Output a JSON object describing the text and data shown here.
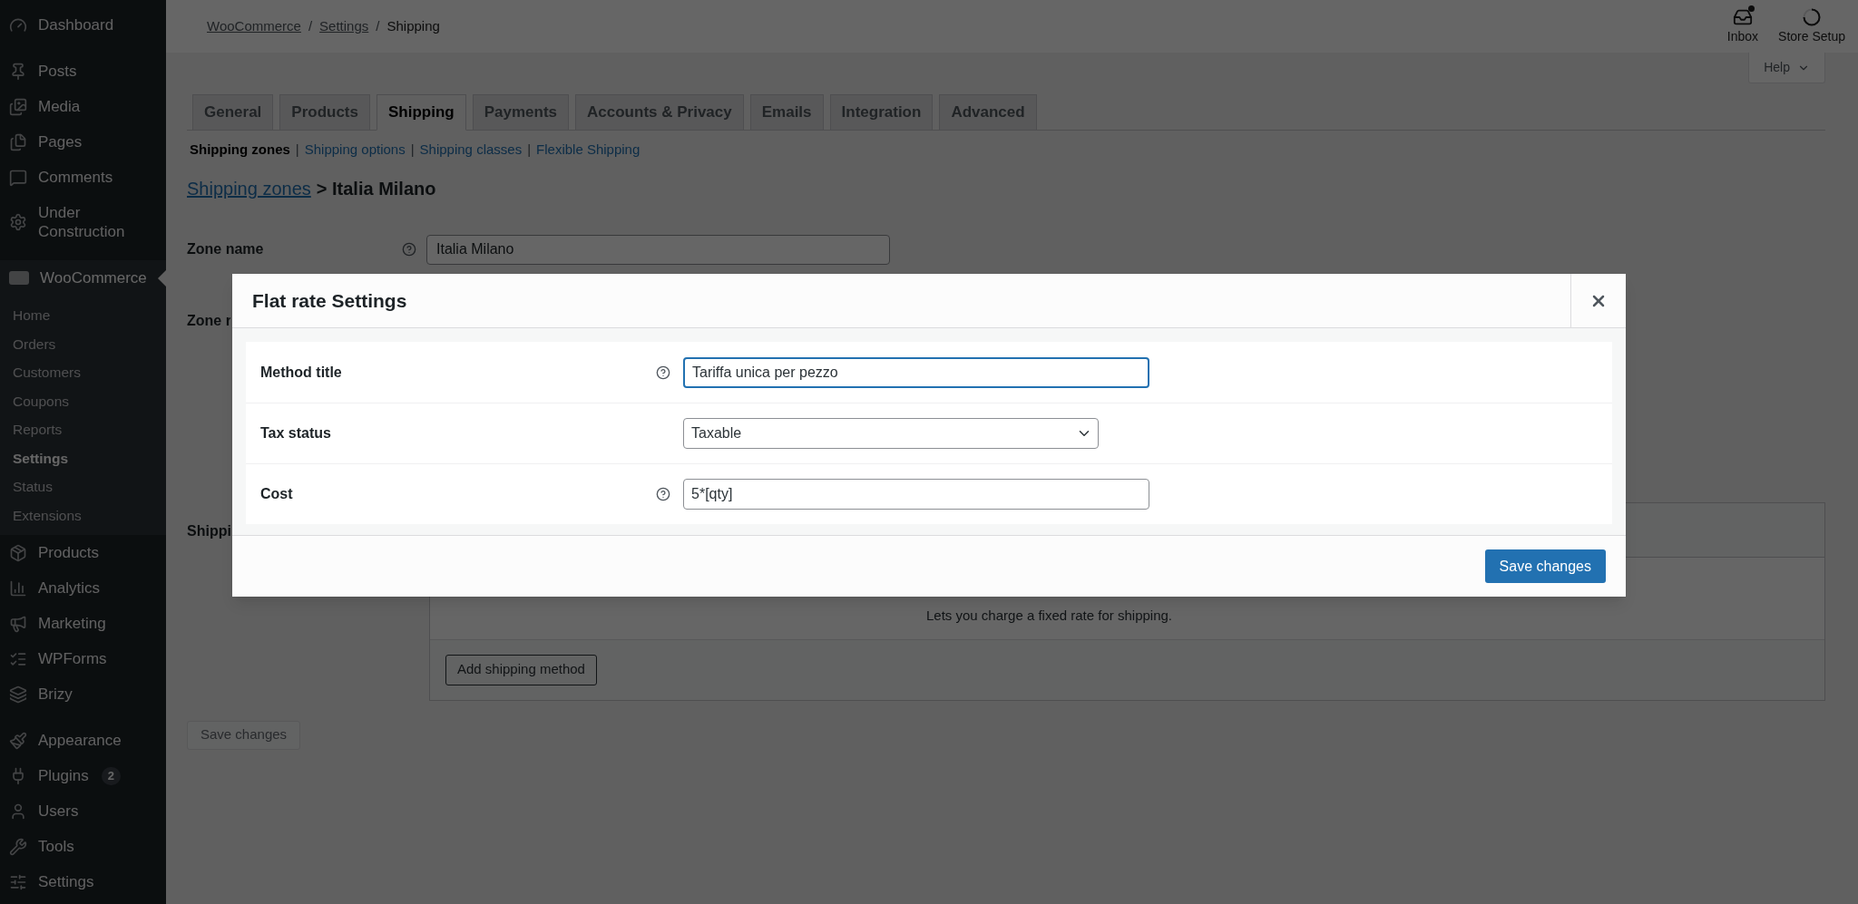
{
  "sidebar": {
    "sections": [
      [
        {
          "label": "Dashboard",
          "selected": false
        }
      ],
      [
        {
          "label": "Posts",
          "selected": false
        },
        {
          "label": "Media",
          "selected": false
        },
        {
          "label": "Pages",
          "selected": false
        },
        {
          "label": "Comments",
          "selected": false
        },
        {
          "label": "Under Construction",
          "selected": false
        }
      ],
      [
        {
          "label": "WooCommerce",
          "selected": true,
          "children": [
            {
              "label": "Home",
              "selected": false
            },
            {
              "label": "Orders",
              "selected": false
            },
            {
              "label": "Customers",
              "selected": false
            },
            {
              "label": "Coupons",
              "selected": false
            },
            {
              "label": "Reports",
              "selected": false
            },
            {
              "label": "Settings",
              "selected": true
            },
            {
              "label": "Status",
              "selected": false
            },
            {
              "label": "Extensions",
              "selected": false
            }
          ]
        },
        {
          "label": "Products",
          "selected": false
        },
        {
          "label": "Analytics",
          "selected": false
        },
        {
          "label": "Marketing",
          "selected": false
        },
        {
          "label": "WPForms",
          "selected": false
        },
        {
          "label": "Brizy",
          "selected": false
        }
      ],
      [
        {
          "label": "Appearance",
          "selected": false
        },
        {
          "label": "Plugins",
          "selected": false,
          "badge": "2"
        },
        {
          "label": "Users",
          "selected": false
        },
        {
          "label": "Tools",
          "selected": false
        },
        {
          "label": "Settings",
          "selected": false
        }
      ]
    ]
  },
  "breadcrumb": {
    "separator": "/",
    "items": [
      {
        "label": "WooCommerce",
        "link": true
      },
      {
        "label": "Settings",
        "link": true
      },
      {
        "label": "Shipping",
        "link": false
      }
    ]
  },
  "top_actions": [
    {
      "label": "Inbox"
    },
    {
      "label": "Store Setup"
    }
  ],
  "help_button": {
    "label": "Help"
  },
  "tabs": [
    {
      "label": "General",
      "selected": false
    },
    {
      "label": "Products",
      "selected": false
    },
    {
      "label": "Shipping",
      "selected": true
    },
    {
      "label": "Payments",
      "selected": false
    },
    {
      "label": "Accounts & Privacy",
      "selected": false
    },
    {
      "label": "Emails",
      "selected": false
    },
    {
      "label": "Integration",
      "selected": false
    },
    {
      "label": "Advanced",
      "selected": false
    }
  ],
  "subnav": {
    "separator": "|",
    "items": [
      {
        "label": "Shipping zones",
        "selected": true
      },
      {
        "label": "Shipping options",
        "selected": false
      },
      {
        "label": "Shipping classes",
        "selected": false
      },
      {
        "label": "Flexible Shipping",
        "selected": false
      }
    ]
  },
  "heading": {
    "link": "Shipping zones",
    "rest": "> Italia Milano"
  },
  "zone_name": {
    "label": "Zone name",
    "value": "Italia Milano"
  },
  "zone_regions_label": "Zone r",
  "shipping_methods_label": "Shippi",
  "methods_table": {
    "description": "Lets you charge a fixed rate for shipping.",
    "add_button": "Add shipping method"
  },
  "page_save_button": {
    "label": "Save changes",
    "disabled": true
  },
  "modal": {
    "title": "Flat rate Settings",
    "fields": [
      {
        "kind": "text",
        "label": "Method title",
        "help": true,
        "value": "Tariffa unica per pezzo",
        "focused": true
      },
      {
        "kind": "select",
        "label": "Tax status",
        "help": false,
        "value": "Taxable"
      },
      {
        "kind": "text",
        "label": "Cost",
        "help": true,
        "value": "5*[qty]",
        "focused": false
      }
    ],
    "save_button": "Save changes"
  }
}
